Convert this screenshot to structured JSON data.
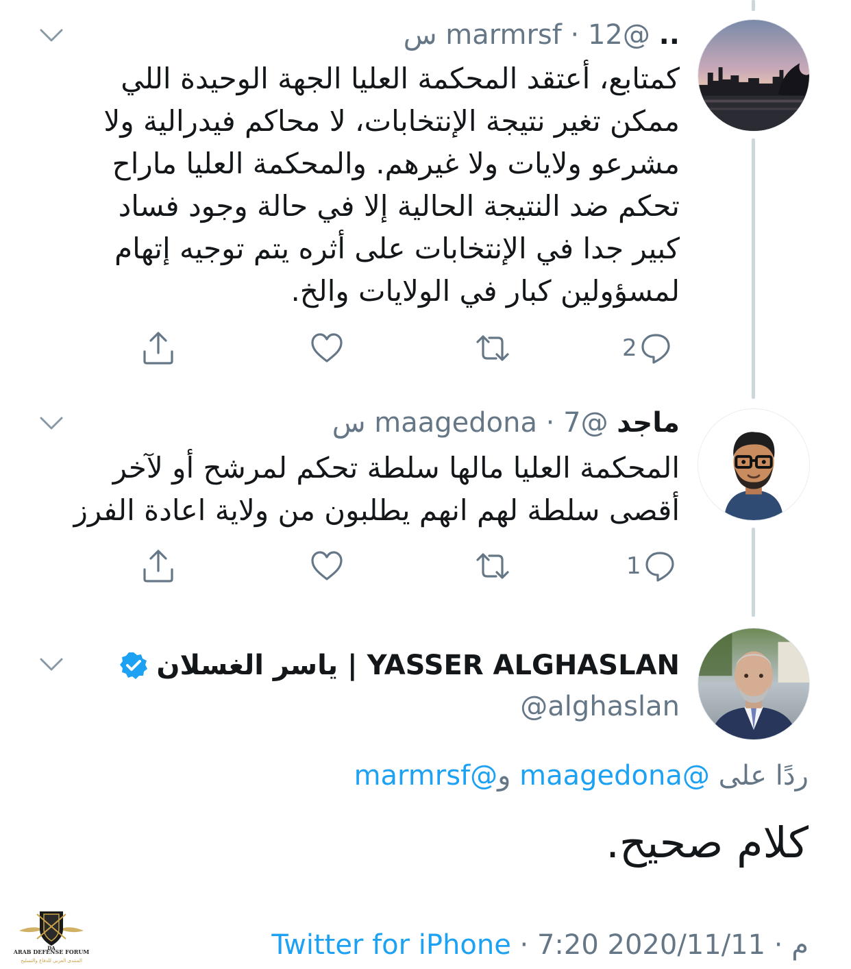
{
  "tweets": [
    {
      "name": "..",
      "handle": "@marmrsf",
      "separator": " · ",
      "time": "12 س",
      "lines": [
        "كمتابع، أعتقد المحكمة العليا الجهة الوحيدة اللي",
        "ممكن تغير نتيجة الإنتخابات، لا محاكم فيدرالية ولا",
        "مشرعو ولايات ولا غيرهم. والمحكمة العليا ماراح",
        "تحكم ضد النتيجة الحالية إلا في حالة وجود فساد",
        "كبير جدا في الإنتخابات على أثره يتم توجيه إتهام",
        "لمسؤولين كبار في الولايات والخ."
      ],
      "reply_count": "2",
      "avatar_icon": "city-skyline-avatar-icon"
    },
    {
      "name": "ماجد",
      "handle": "@maagedona",
      "separator": " · ",
      "time": "7 س",
      "lines": [
        "المحكمة العليا مالها سلطة تحكم لمرشح أو لآخر",
        "أقصى سلطة لهم انهم يطلبون من ولاية اعادة الفرز"
      ],
      "reply_count": "1",
      "avatar_icon": "cartoon-man-avatar-icon"
    }
  ],
  "main_tweet": {
    "name": "ياسر الغسلان | YASSER ALGHASLAN",
    "handle": "@alghaslan",
    "reply_prefix": "ردًا على ",
    "reply_handle_1": "@maagedona",
    "reply_and": " و",
    "reply_handle_2": "@marmrsf",
    "text": "كلام صحيح.",
    "date": "2020/11/11",
    "dot": " · ",
    "time": "7:20 م",
    "source": "Twitter for iPhone",
    "avatar_icon": "man-portrait-avatar-icon"
  },
  "colors": {
    "link": "#1da1f2",
    "secondary": "#657786",
    "thread_line": "#ccd6dd"
  }
}
